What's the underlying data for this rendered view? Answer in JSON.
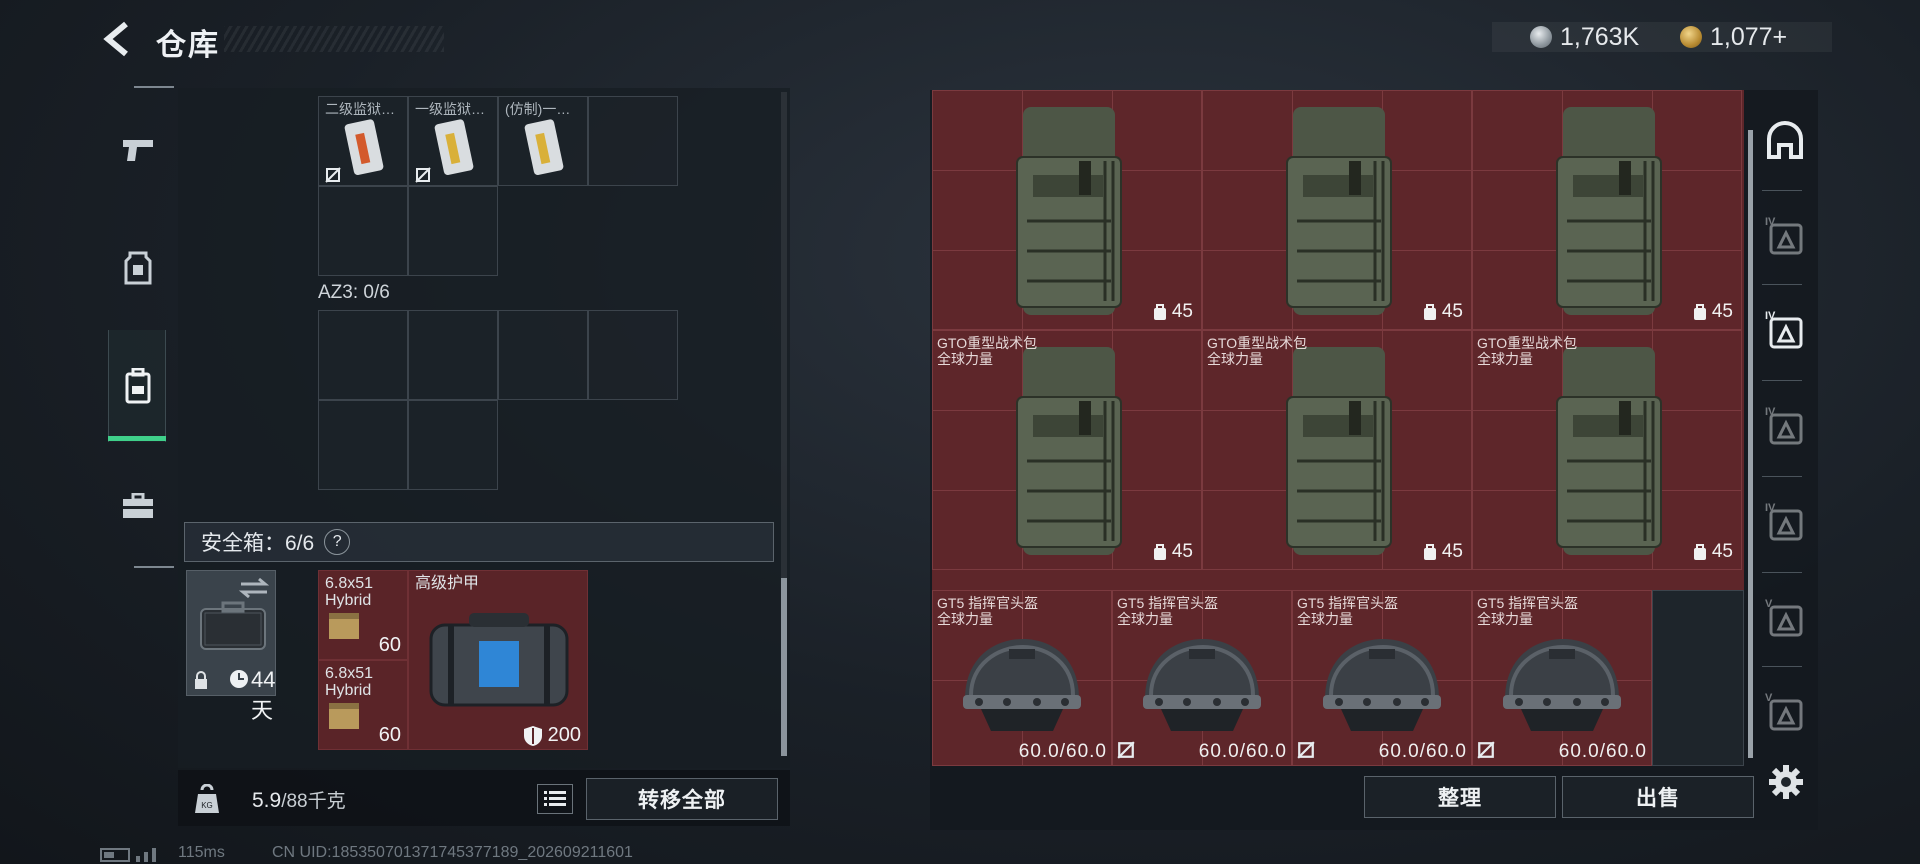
{
  "header": {
    "title": "仓库",
    "currency": [
      {
        "icon": "silver-coin-icon",
        "value": "1,763K"
      },
      {
        "icon": "gold-coin-icon",
        "value": "1,077+"
      }
    ]
  },
  "nav": {
    "items": [
      {
        "name": "weapons",
        "icon": "pistol-icon"
      },
      {
        "name": "armor",
        "icon": "armor-vest-icon"
      },
      {
        "name": "backpack",
        "icon": "backpack-icon",
        "active": true
      },
      {
        "name": "toolbox",
        "icon": "toolbox-icon"
      }
    ]
  },
  "left": {
    "top_items": [
      {
        "name": "二级监狱…"
      },
      {
        "name": "一级监狱…"
      },
      {
        "name": "(仿制)一…"
      }
    ],
    "az_label": "AZ3: 0/6",
    "safe_box_label": "安全箱：6/6",
    "help": "?",
    "safe_case_days": "44天",
    "ammo": [
      {
        "name": "6.8x51\nHybrid",
        "count": "60"
      },
      {
        "name": "6.8x51\nHybrid",
        "count": "60"
      }
    ],
    "armor": {
      "name": "高级护甲",
      "value": "200"
    }
  },
  "bottom": {
    "weight_value": "5.9",
    "weight_unit": "/88千克",
    "transfer_all": "转移全部"
  },
  "footer": {
    "ping": "115ms",
    "uid": "CN UID:185350701371745377189_202609211601"
  },
  "grid": {
    "backpacks": [
      {
        "name": "",
        "sub": "",
        "capacity": "45"
      },
      {
        "name": "",
        "sub": "",
        "capacity": "45"
      },
      {
        "name": "",
        "sub": "",
        "capacity": "45"
      },
      {
        "name": "GTO重型战术包",
        "sub": "全球力量",
        "capacity": "45"
      },
      {
        "name": "GTO重型战术包",
        "sub": "全球力量",
        "capacity": "45"
      },
      {
        "name": "GTO重型战术包",
        "sub": "全球力量",
        "capacity": "45"
      }
    ],
    "helmets": [
      {
        "name": "GT5 指挥官头盔",
        "sub": "全球力量",
        "durability": "60.0/60.0"
      },
      {
        "name": "GT5 指挥官头盔",
        "sub": "全球力量",
        "durability": "60.0/60.0"
      },
      {
        "name": "GT5 指挥官头盔",
        "sub": "全球力量",
        "durability": "60.0/60.0"
      },
      {
        "name": "GT5 指挥官头盔",
        "sub": "全球力量",
        "durability": "60.0/60.0"
      }
    ]
  },
  "actions": {
    "organize": "整理",
    "sell": "出售"
  },
  "side_tabs": [
    {
      "icon": "helmet-tab-icon"
    },
    {
      "icon": "armor-tier-iv-icon"
    },
    {
      "icon": "backpack-tier-iv-icon",
      "active": true
    },
    {
      "icon": "chestrig-tier-iv-icon"
    },
    {
      "icon": "folder-tier-iv-icon"
    },
    {
      "icon": "case-tier-v-icon"
    },
    {
      "icon": "case-tier-v-alt-icon"
    }
  ],
  "colors": {
    "accent_green": "#3fd08a",
    "grid_red": "#5e262a"
  }
}
